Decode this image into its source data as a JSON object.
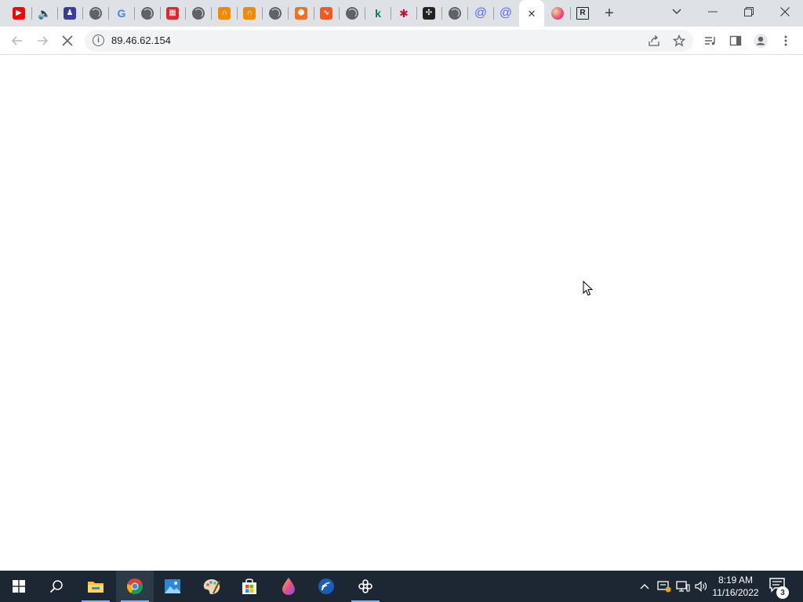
{
  "browser": {
    "tabs": [
      {
        "icon": "youtube-icon",
        "color": "#ff0000",
        "glyph": "▶"
      },
      {
        "icon": "audio-playing-icon",
        "color": "#3c4043",
        "glyph": "🔈"
      },
      {
        "icon": "profile-picture-icon",
        "color": "#3a3aa0",
        "glyph": "♟"
      },
      {
        "icon": "globe-icon",
        "color": "#5f6368",
        "glyph": ""
      },
      {
        "icon": "google-icon",
        "color": "#4285f4",
        "glyph": "G"
      },
      {
        "icon": "globe-icon",
        "color": "#5f6368",
        "glyph": ""
      },
      {
        "icon": "red-grid-icon",
        "color": "#e0262b",
        "glyph": "▦"
      },
      {
        "icon": "globe-icon",
        "color": "#5f6368",
        "glyph": ""
      },
      {
        "icon": "orange-lock-icon",
        "color": "#f08a00",
        "glyph": "∩"
      },
      {
        "icon": "orange-lock-icon",
        "color": "#f08a00",
        "glyph": "∩"
      },
      {
        "icon": "globe-icon",
        "color": "#5f6368",
        "glyph": ""
      },
      {
        "icon": "orange-cube-icon",
        "color": "#f37021",
        "glyph": "⬢"
      },
      {
        "icon": "orange-wave-icon",
        "color": "#f15a24",
        "glyph": "∿"
      },
      {
        "icon": "globe-icon",
        "color": "#5f6368",
        "glyph": ""
      },
      {
        "icon": "k-logo-icon",
        "color": "#0b7a5a",
        "glyph": "k"
      },
      {
        "icon": "star-burst-icon",
        "color": "#c8102e",
        "glyph": "✱"
      },
      {
        "icon": "dark-knot-icon",
        "color": "#222222",
        "glyph": "✣"
      },
      {
        "icon": "globe-icon",
        "color": "#5f6368",
        "glyph": ""
      },
      {
        "icon": "at-sign-icon",
        "color": "#5b6bf5",
        "glyph": "@"
      },
      {
        "icon": "at-sign-icon",
        "color": "#5b6bf5",
        "glyph": "@"
      },
      {
        "icon": "close-icon",
        "color": "#3c4043",
        "glyph": "✕",
        "active": true
      },
      {
        "icon": "gradient-orb-icon",
        "color": "#e84d6b",
        "glyph": "●"
      },
      {
        "icon": "r-logo-icon",
        "color": "#202124",
        "glyph": "R"
      }
    ],
    "address": "89.46.62.154"
  },
  "taskbar": {
    "clock_time": "8:19 AM",
    "clock_date": "11/16/2022",
    "notification_count": "3",
    "accent": "#1c2733"
  }
}
